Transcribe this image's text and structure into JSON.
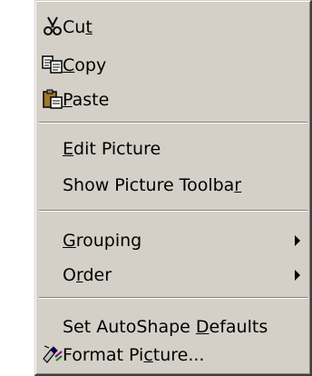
{
  "menu": {
    "items": [
      {
        "pre": "Cu",
        "key": "t",
        "post": "",
        "icon": "cut-scissors-icon"
      },
      {
        "pre": "",
        "key": "C",
        "post": "opy",
        "icon": "copy-icon"
      },
      {
        "pre": "",
        "key": "P",
        "post": "aste",
        "icon": "paste-clipboard-icon"
      },
      {
        "pre": "",
        "key": "E",
        "post": "dit Picture"
      },
      {
        "pre": "Show Picture Toolba",
        "key": "r",
        "post": ""
      },
      {
        "pre": "",
        "key": "G",
        "post": "rouping",
        "submenu": true
      },
      {
        "pre": "O",
        "key": "r",
        "post": "der",
        "submenu": true
      },
      {
        "pre": "Set AutoShape ",
        "key": "D",
        "post": "efaults"
      },
      {
        "pre": "Format Pi",
        "key": "c",
        "post": "ture...",
        "icon": "format-picture-icon"
      }
    ]
  },
  "colors": {
    "menu_face": "#d4d0c8",
    "highlight": "#ffffff",
    "shadow": "#808080"
  }
}
